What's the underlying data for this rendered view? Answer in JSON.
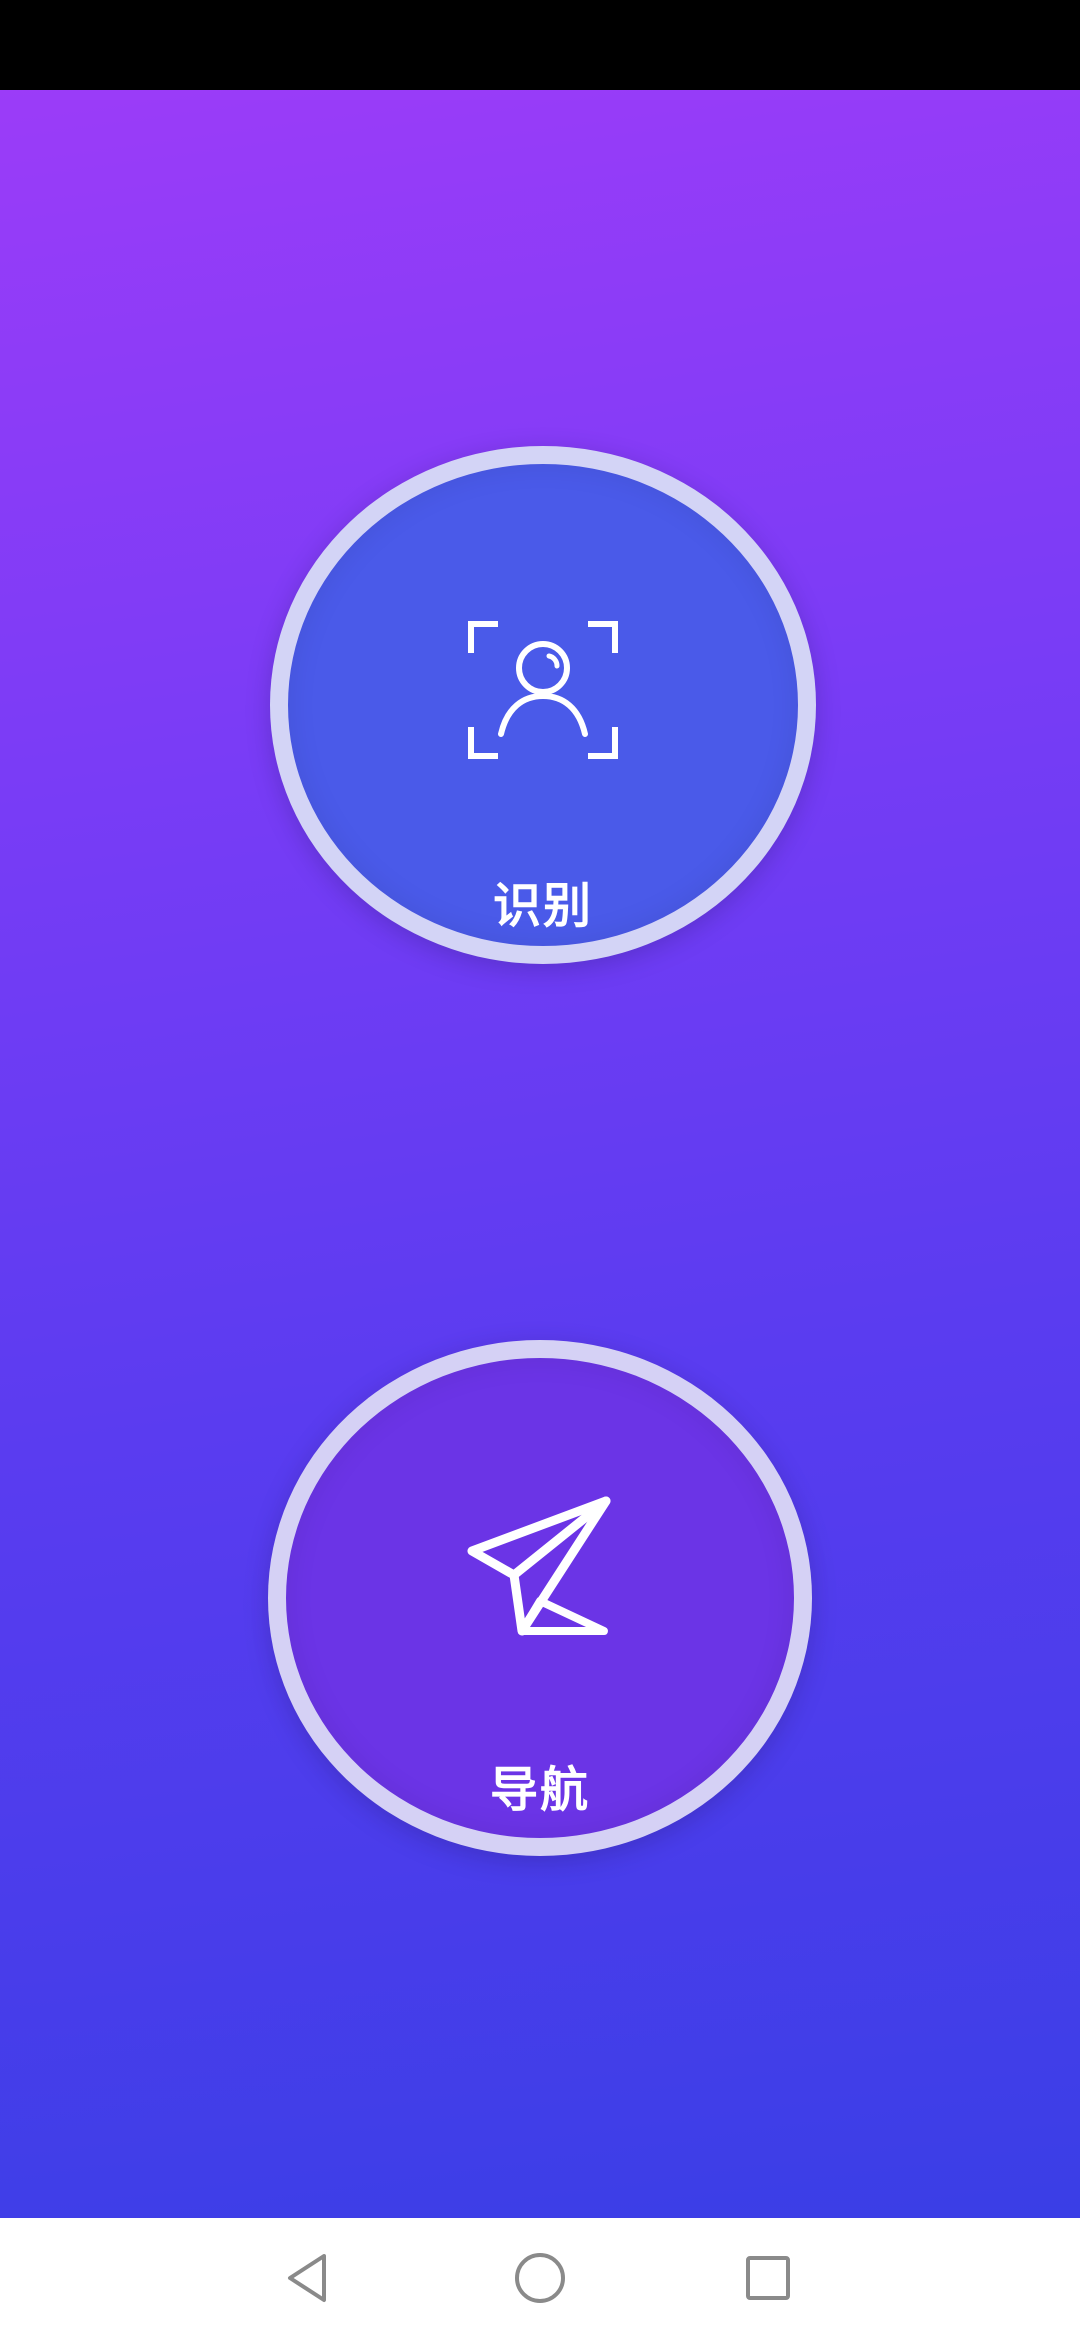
{
  "main": {
    "buttons": [
      {
        "label": "识别",
        "icon": "face-scan-icon"
      },
      {
        "label": "导航",
        "icon": "paper-plane-icon"
      }
    ]
  },
  "system_nav": {
    "icons": [
      "back-triangle-icon",
      "home-circle-icon",
      "recents-square-icon"
    ]
  },
  "colors": {
    "background_top": "#9b3cf8",
    "background_bottom": "#3a3ee6",
    "recognize_button": "#4a5ae9",
    "navigate_button": "#6b34e6",
    "button_ring": "#dedef6"
  }
}
